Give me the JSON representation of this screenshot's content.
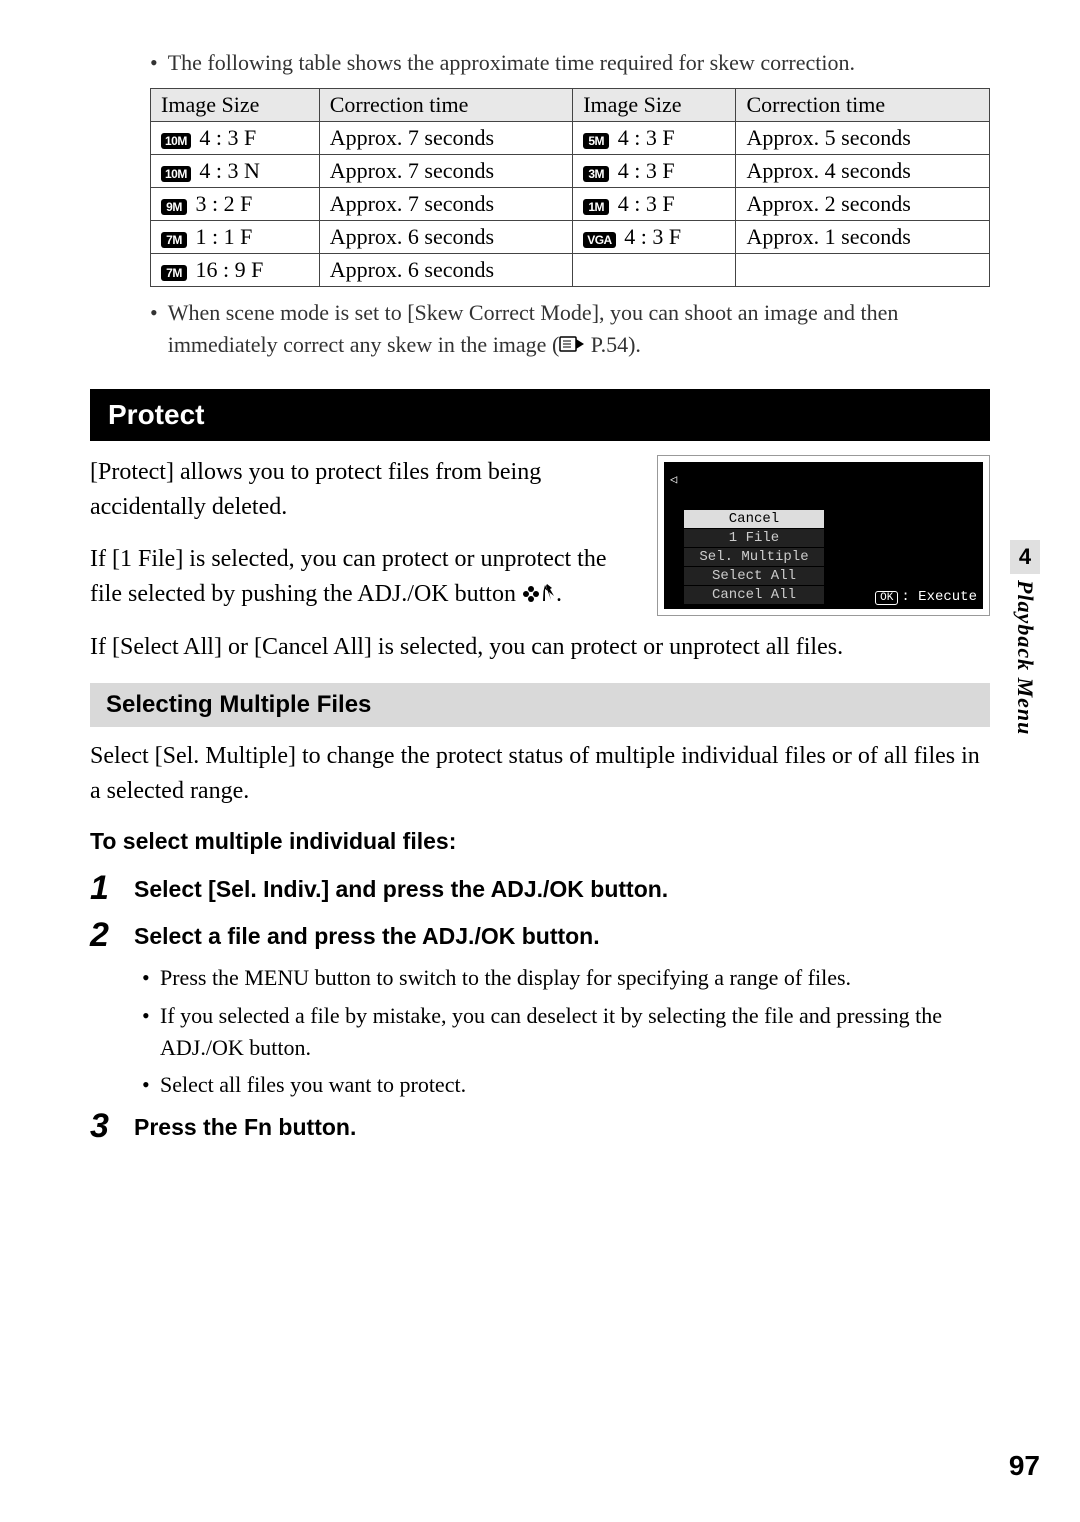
{
  "intro_bullet": "The following table shows the approximate time required for skew correction.",
  "table": {
    "headers": [
      "Image Size",
      "Correction time",
      "Image Size",
      "Correction time"
    ],
    "rows": [
      {
        "badge1": "10M",
        "size1": "4 : 3 F",
        "time1": "Approx. 7 seconds",
        "badge2": "5M",
        "size2": "4 : 3 F",
        "time2": "Approx. 5 seconds"
      },
      {
        "badge1": "10M",
        "size1": "4 : 3 N",
        "time1": "Approx. 7 seconds",
        "badge2": "3M",
        "size2": "4 : 3 F",
        "time2": "Approx. 4 seconds"
      },
      {
        "badge1": "9M",
        "size1": "3 : 2 F",
        "time1": "Approx. 7 seconds",
        "badge2": "1M",
        "size2": "4 : 3 F",
        "time2": "Approx. 2 seconds"
      },
      {
        "badge1": "7M",
        "size1": "1 : 1 F",
        "time1": "Approx. 6 seconds",
        "badge2": "VGA",
        "size2": "4 : 3 F",
        "time2": "Approx. 1 seconds"
      },
      {
        "badge1": "7M",
        "size1": "16 : 9 F",
        "time1": "Approx. 6 seconds",
        "badge2": "",
        "size2": "",
        "time2": ""
      }
    ]
  },
  "note_bullet_prefix": "When scene mode is set to [Skew Correct Mode], you can shoot an image and then immediately correct any skew in the image (",
  "note_bullet_suffix": " P.54).",
  "heading_protect": "Protect",
  "protect_intro": "[Protect] allows you to protect files from being accidentally deleted.",
  "protect_p2_prefix": "If [1 File] is selected, you can protect or unprotect the file selected by pushing the ADJ./OK button ",
  "protect_p2_suffix": ".",
  "protect_p3": "If [Select All] or [Cancel All] is selected, you can protect or unprotect all files.",
  "screenshot": {
    "items": [
      "Cancel",
      "1 File",
      "Sel. Multiple",
      "Select All",
      "Cancel All"
    ],
    "ok_label": "OK",
    "execute_label": ": Execute"
  },
  "subheading_selecting": "Selecting Multiple Files",
  "selecting_intro": "Select [Sel. Multiple] to change the protect status of multiple individual files or of all files in a selected range.",
  "sub_to_select": "To select multiple individual files:",
  "steps": [
    {
      "num": "1",
      "title": "Select [Sel. Indiv.] and press the ADJ./OK button.",
      "bullets": []
    },
    {
      "num": "2",
      "title": "Select a file and press the ADJ./OK button.",
      "bullets": [
        "Press the MENU button to switch to the display for specifying a range of files.",
        "If you selected a file by mistake, you can deselect it by selecting the file and pressing the ADJ./OK button.",
        "Select all files you want to protect."
      ]
    },
    {
      "num": "3",
      "title": "Press the Fn button.",
      "bullets": []
    }
  ],
  "side_tab_number": "4",
  "side_tab_label": "Playback Menu",
  "page_number": "97"
}
